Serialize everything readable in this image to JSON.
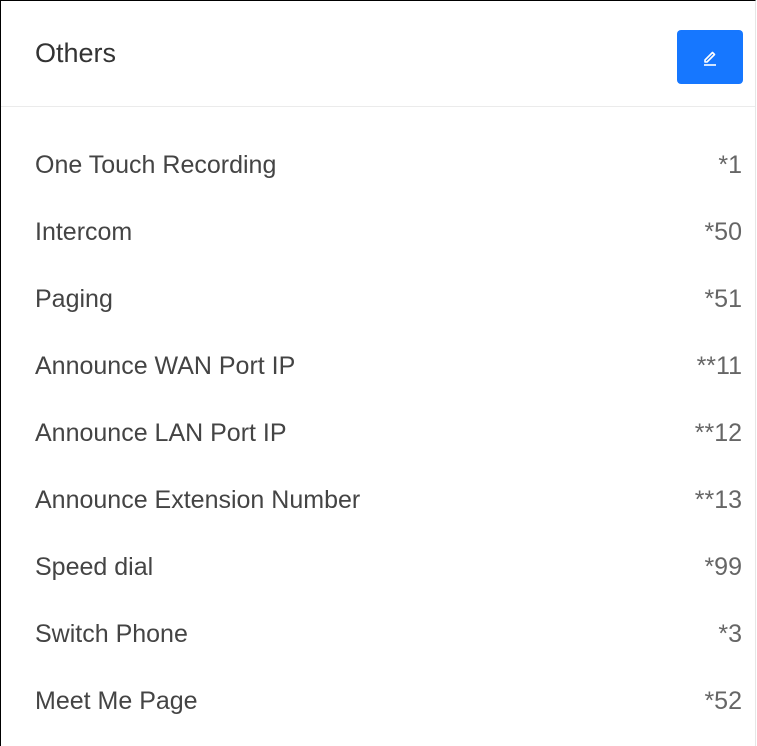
{
  "panel": {
    "title": "Others",
    "edit_icon": "pencil-edit-icon",
    "accent_color": "#1677ff"
  },
  "items": [
    {
      "label": "One Touch Recording",
      "code": "*1"
    },
    {
      "label": "Intercom",
      "code": "*50"
    },
    {
      "label": "Paging",
      "code": "*51"
    },
    {
      "label": "Announce WAN Port IP",
      "code": "**11"
    },
    {
      "label": "Announce LAN Port IP",
      "code": "**12"
    },
    {
      "label": "Announce Extension Number",
      "code": "**13"
    },
    {
      "label": "Speed dial",
      "code": "*99"
    },
    {
      "label": "Switch Phone",
      "code": "*3"
    },
    {
      "label": "Meet Me Page",
      "code": "*52"
    }
  ]
}
